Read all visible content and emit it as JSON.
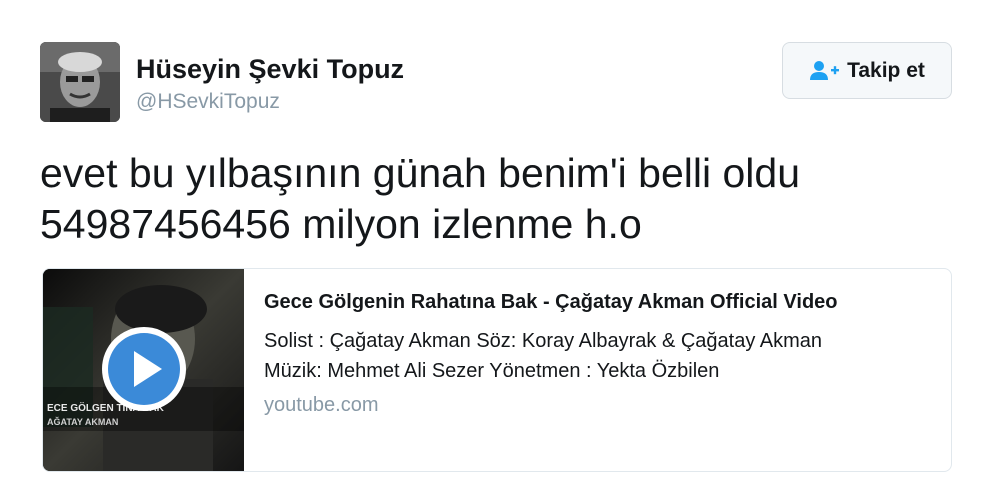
{
  "user": {
    "display_name": "Hüseyin Şevki Topuz",
    "handle": "@HSevkiTopuz"
  },
  "follow_button": {
    "label": "Takip et",
    "icon": "add-user-icon",
    "color": "#1da1f2"
  },
  "tweet": {
    "lines": [
      "evet bu yılbaşının günah benim'i belli oldu",
      "54987456456 milyon izlenme h.o"
    ]
  },
  "card": {
    "title": "Gece Gölgenin Rahatına Bak - Çağatay Akman Official Video",
    "description_lines": [
      "Solist : Çağatay Akman Söz: Koray Albayrak & Çağatay Akman",
      "Müzik: Mehmet Ali Sezer Yönetmen : Yekta Özbilen"
    ],
    "domain": "youtube.com",
    "thumbnail": {
      "overlay_line1": "ECE GÖLGEN   TINA BAK",
      "overlay_line2": "AĞATAY AKMAN",
      "play_icon": "play-icon",
      "play_color": "#3b8ad8"
    }
  }
}
